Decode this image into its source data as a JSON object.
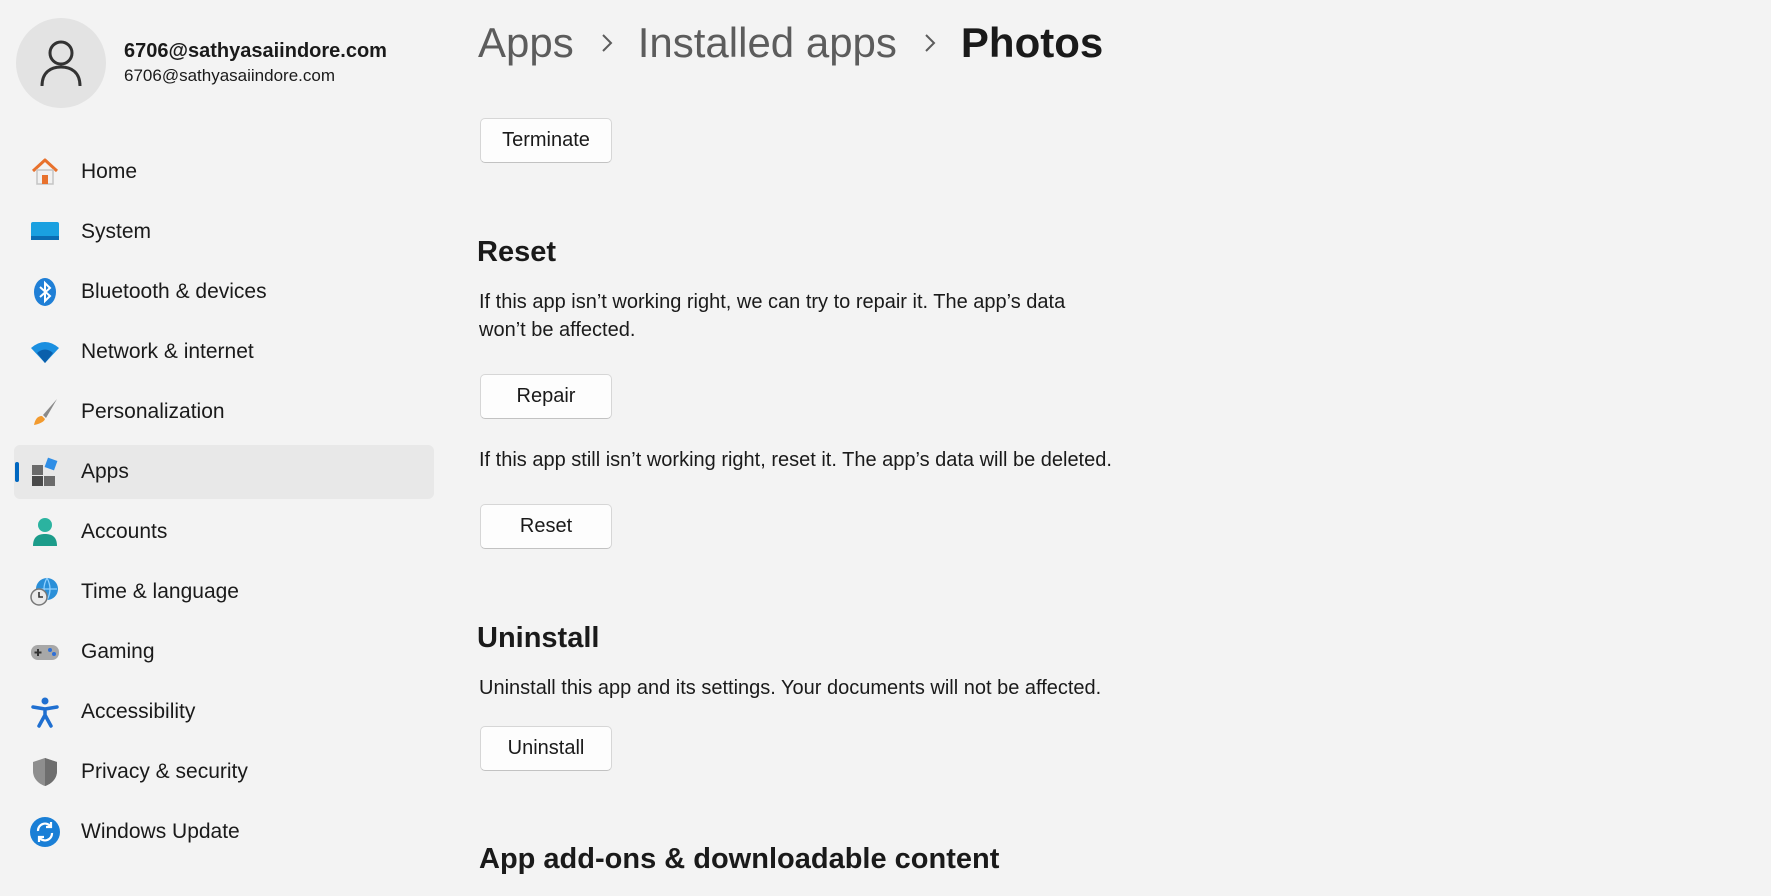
{
  "profile": {
    "name": "6706@sathyasaiindore.com",
    "email": "6706@sathyasaiindore.com"
  },
  "sidebar": {
    "items": [
      {
        "label": "Home",
        "icon": "home-icon"
      },
      {
        "label": "System",
        "icon": "system-icon"
      },
      {
        "label": "Bluetooth & devices",
        "icon": "bluetooth-icon"
      },
      {
        "label": "Network & internet",
        "icon": "wifi-icon"
      },
      {
        "label": "Personalization",
        "icon": "brush-icon"
      },
      {
        "label": "Apps",
        "icon": "apps-icon",
        "active": true
      },
      {
        "label": "Accounts",
        "icon": "account-icon"
      },
      {
        "label": "Time & language",
        "icon": "globe-clock-icon"
      },
      {
        "label": "Gaming",
        "icon": "gamepad-icon"
      },
      {
        "label": "Accessibility",
        "icon": "accessibility-icon"
      },
      {
        "label": "Privacy & security",
        "icon": "shield-icon"
      },
      {
        "label": "Windows Update",
        "icon": "update-icon"
      }
    ]
  },
  "breadcrumb": [
    "Apps",
    "Installed apps",
    "Photos"
  ],
  "terminate": {
    "button": "Terminate"
  },
  "reset": {
    "title": "Reset",
    "repair_desc_line1": "If this app isn’t working right, we can try to repair it. The app’s data",
    "repair_desc_line2": "won’t be affected.",
    "repair_button": "Repair",
    "reset_desc": "If this app still isn’t working right, reset it. The app’s data will be deleted.",
    "reset_button": "Reset"
  },
  "uninstall": {
    "title": "Uninstall",
    "desc": "Uninstall this app and its settings. Your documents will not be affected.",
    "button": "Uninstall"
  },
  "addons": {
    "title": "App add-ons & downloadable content"
  },
  "colors": {
    "accent": "#0067c0",
    "background": "#f3f3f3",
    "active_item": "#e8e8e8"
  }
}
